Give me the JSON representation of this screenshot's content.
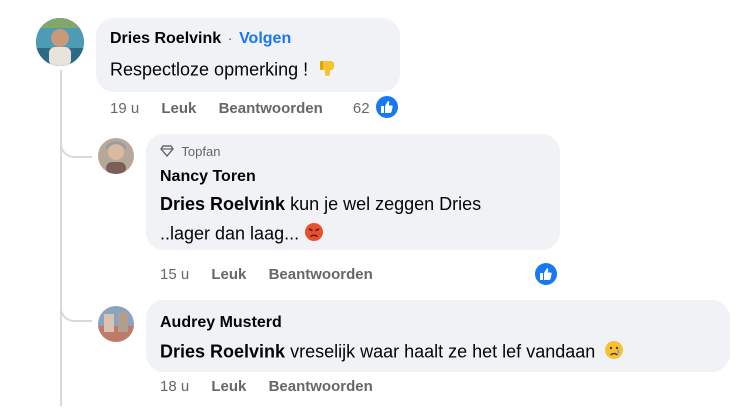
{
  "comments": [
    {
      "author": "Dries Roelvink",
      "separator": "·",
      "follow_label": "Volgen",
      "text": "Respectloze opmerking !",
      "emoji_icon": "thumbs-down-emoji",
      "time": "19 u",
      "like_label": "Leuk",
      "reply_label": "Beantwoorden",
      "reaction_count": "62",
      "reaction_icon": "like-icon"
    },
    {
      "badge_icon": "diamond-icon",
      "badge_label": "Topfan",
      "author": "Nancy Toren",
      "mention": "Dries Roelvink",
      "text_line1": "kun je wel zeggen Dries",
      "text_line2": "..lager dan laag...",
      "emoji_icon": "angry-face-emoji",
      "time": "15 u",
      "like_label": "Leuk",
      "reply_label": "Beantwoorden",
      "reaction_icon": "like-icon"
    },
    {
      "author": "Audrey Musterd",
      "mention": "Dries Roelvink",
      "text": "vreselijk waar haalt ze het lef vandaan",
      "emoji_icon": "sad-face-emoji",
      "time": "18 u",
      "like_label": "Leuk",
      "reply_label": "Beantwoorden"
    }
  ],
  "colors": {
    "bubble": "#f0f2f5",
    "link_blue": "#1877f2",
    "meta_gray": "#65676b",
    "thread_line": "#d6d9de"
  }
}
